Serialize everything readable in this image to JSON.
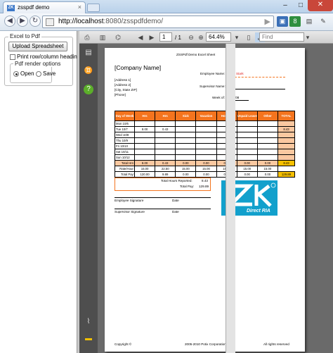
{
  "browser": {
    "tab_title": "zsspdf demo",
    "tab_favicon": "ZK",
    "url_host": "http://localhost",
    "url_rest": ":8080/zsspdfdemo/"
  },
  "left_panel": {
    "group_title": "Excel to Pdf",
    "upload_button": "Upload Spreadsheet",
    "print_headings_label": "Print row/column headings",
    "print_headings_checked": false,
    "render_group_title": "Pdf render options",
    "radio_open": "Open",
    "radio_save": "Save",
    "selected": "Open"
  },
  "pdf_toolbar": {
    "page_current": "1",
    "page_total": "/ 1",
    "zoom": "64.4%",
    "find_placeholder": "Find"
  },
  "document": {
    "title": "ZSSPdf Demo Excel Sheet",
    "company": "[Company Name]",
    "address1": "[Address 1]",
    "address2": "[Address 2]",
    "city_state_zip": "[City, State ZIP]",
    "phone": "[Phone]",
    "employee_name_label": "Employee Name:",
    "employee_name": "Tony Stark",
    "supervisor_name_label": "Supervisor Name:",
    "week_of_label": "Week of:",
    "week_of": "10/6/08",
    "columns": [
      "Day of Week",
      "Hrs",
      "Hrs",
      "Sick",
      "Vacation",
      "Holiday",
      "Unpaid Leave",
      "Other",
      "TOTAL"
    ],
    "rows": [
      {
        "day": "Mon 10/6",
        "cells": [
          "",
          "",
          "",
          "",
          "",
          "",
          ""
        ],
        "total": ""
      },
      {
        "day": "Tue 10/7",
        "cells": [
          "8.00",
          "0.43",
          "",
          "",
          "",
          "",
          ""
        ],
        "total": "8.43"
      },
      {
        "day": "Wed 10/8",
        "cells": [
          "",
          "",
          "",
          "",
          "",
          "",
          ""
        ],
        "total": ""
      },
      {
        "day": "Thu 10/9",
        "cells": [
          "",
          "",
          "",
          "",
          "",
          "",
          ""
        ],
        "total": ""
      },
      {
        "day": "Fri 10/10",
        "cells": [
          "",
          "",
          "",
          "",
          "",
          "",
          ""
        ],
        "total": ""
      },
      {
        "day": "Sat 10/11",
        "cells": [
          "",
          "",
          "",
          "",
          "",
          "",
          ""
        ],
        "total": ""
      },
      {
        "day": "Sun 10/12",
        "cells": [
          "",
          "",
          "",
          "",
          "",
          "",
          ""
        ],
        "total": ""
      }
    ],
    "total_hrs": {
      "label": "Total Hrs:",
      "cells": [
        "8.00",
        "0.43",
        "0.00",
        "0.00",
        "0.00",
        "0.00",
        "0.00"
      ],
      "total": "8.43"
    },
    "rate": {
      "label": "Rate/Hour:",
      "cells": [
        "15.00",
        "22.50",
        "15.00",
        "15.00",
        "15.00",
        "15.00",
        "15.00"
      ]
    },
    "total_pay": {
      "label": "Total Pay:",
      "cells": [
        "120.00",
        "9.89",
        "0.00",
        "0.00",
        "0.00",
        "0.00",
        "0.00"
      ],
      "total": "129.89"
    },
    "total_hours_reported_label": "Total Hours Reported:",
    "total_hours_reported": "8.43",
    "total_pay_label": "Total Pay:",
    "total_pay_value": "129.89",
    "employee_signature": "Employee Signature",
    "supervisor_signature": "Supervisor Signature",
    "date_label": "Date",
    "logo_text": "Direct RIA",
    "logo_mark": "zk",
    "footer_copyright": "Copyright ©",
    "footer_corp": "2005-2010 Potix Corporation.",
    "footer_rights": "All rights reserved"
  },
  "colors": {
    "orange": "#f4741e",
    "light_orange": "#fbc8a0",
    "gold": "#f6c000",
    "logo_blue": "#12a0cc"
  }
}
